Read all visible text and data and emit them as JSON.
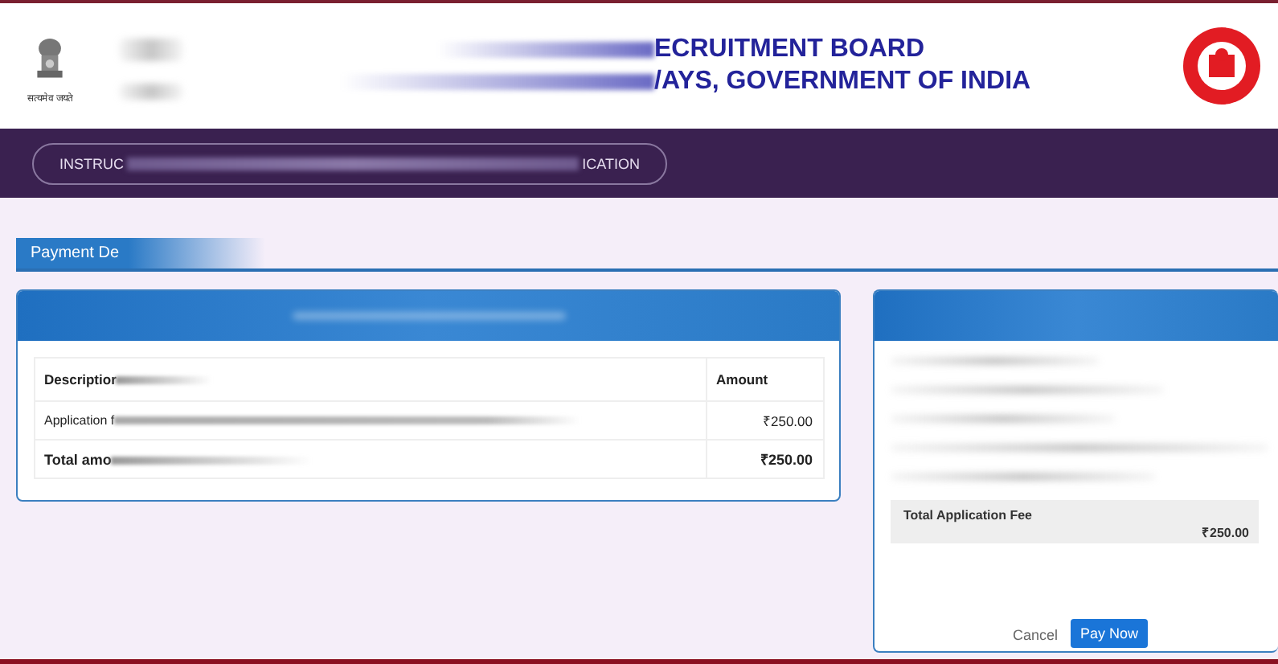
{
  "header": {
    "emblem_motto": "सत्यमेव जयते",
    "title_lines": [
      "ECRUITMENT BOARD",
      "/AYS, GOVERNMENT OF INDIA"
    ]
  },
  "nav": {
    "pill_start": "INSTRUC",
    "pill_end": "ICATION"
  },
  "section_tab": "Payment De",
  "fee_table": {
    "columns": [
      "Descriptior",
      "Amount"
    ],
    "rows": [
      {
        "kind": "item",
        "description": "Application f",
        "amount": "₹250.00"
      },
      {
        "kind": "total",
        "description": "Total amo",
        "amount": "₹250.00"
      }
    ]
  },
  "summary": {
    "label": "Total Application Fee",
    "amount": "₹250.00"
  },
  "buttons": [
    {
      "kind": "link",
      "label": "Cancel"
    },
    {
      "kind": "primary",
      "label": "Pay Now"
    }
  ]
}
